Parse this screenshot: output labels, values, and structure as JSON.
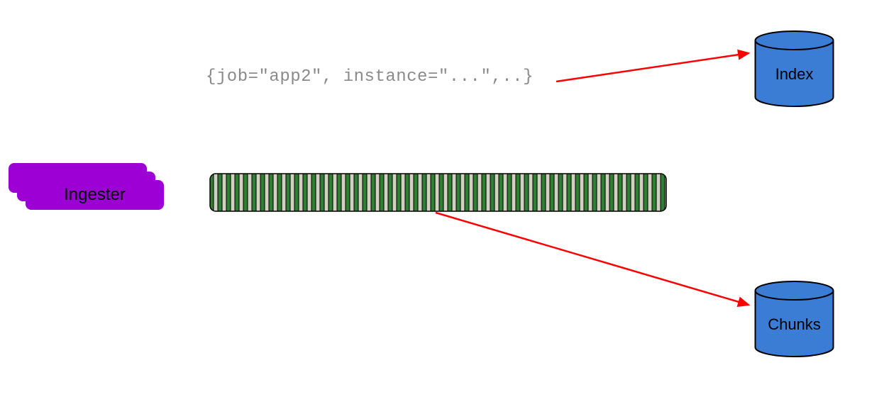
{
  "ingester": {
    "label": "Ingester"
  },
  "logLine": {
    "text": "{job=\"app2\", instance=\"...\",..}"
  },
  "storage": {
    "index": {
      "label": "Index"
    },
    "chunks": {
      "label": "Chunks"
    }
  },
  "colors": {
    "ingester": "#9c00d4",
    "cylinder_fill": "#3b7cd4",
    "cylinder_stroke": "#000000",
    "arrow": "#ff0000",
    "bar_dark": "#2e7d32",
    "bar_light": "#d0d0c0",
    "bar_border": "#000000"
  },
  "chart_data": {
    "type": "diagram",
    "nodes": [
      {
        "id": "ingester",
        "label": "Ingester",
        "kind": "stacked-card",
        "color": "#9c00d4"
      },
      {
        "id": "logline",
        "label": "{job=\"app2\", instance=\"...\",..}",
        "kind": "text"
      },
      {
        "id": "chunk_bar",
        "label": "",
        "kind": "striped-bar",
        "color": "#2e7d32"
      },
      {
        "id": "index",
        "label": "Index",
        "kind": "cylinder-db",
        "color": "#3b7cd4"
      },
      {
        "id": "chunks",
        "label": "Chunks",
        "kind": "cylinder-db",
        "color": "#3b7cd4"
      }
    ],
    "edges": [
      {
        "from": "logline",
        "to": "index",
        "color": "#ff0000"
      },
      {
        "from": "chunk_bar",
        "to": "chunks",
        "color": "#ff0000"
      }
    ]
  }
}
